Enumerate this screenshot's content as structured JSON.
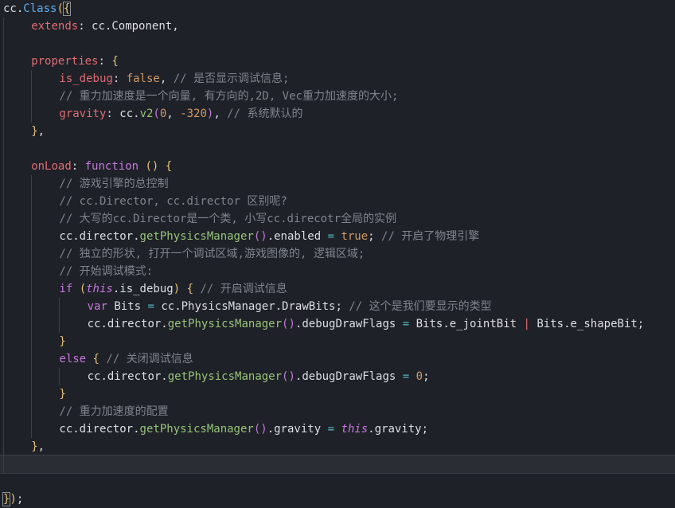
{
  "editor": {
    "lines": [
      {
        "indent": 0,
        "tokens": [
          [
            "cc.",
            ""
          ],
          [
            "Class",
            "fn"
          ],
          [
            "(",
            "br"
          ],
          [
            "{",
            "hl"
          ]
        ]
      },
      {
        "indent": 1,
        "tokens": [
          [
            "extends",
            "prop"
          ],
          [
            ": cc.Component,",
            ""
          ]
        ]
      },
      {
        "indent": 1,
        "tokens": []
      },
      {
        "indent": 1,
        "tokens": [
          [
            "properties",
            "prop"
          ],
          [
            ": ",
            ""
          ],
          [
            "{",
            "br"
          ]
        ]
      },
      {
        "indent": 2,
        "tokens": [
          [
            "is_debug",
            "prop"
          ],
          [
            ": ",
            ""
          ],
          [
            "false",
            "num"
          ],
          [
            ", ",
            ""
          ],
          [
            "// 是否显示调试信息;",
            "cm"
          ]
        ]
      },
      {
        "indent": 2,
        "tokens": [
          [
            "// 重力加速度是一个向量, 有方向的,2D, Vec重力加速度的大小;",
            "cm"
          ]
        ]
      },
      {
        "indent": 2,
        "tokens": [
          [
            "gravity",
            "prop"
          ],
          [
            ": cc.",
            ""
          ],
          [
            "v2",
            "fn-g"
          ],
          [
            "(",
            "pb"
          ],
          [
            "0",
            "num"
          ],
          [
            ", ",
            ""
          ],
          [
            "-320",
            "num"
          ],
          [
            ")",
            "pb"
          ],
          [
            ", ",
            ""
          ],
          [
            "// 系统默认的",
            "cm"
          ]
        ]
      },
      {
        "indent": 1,
        "tokens": [
          [
            "}",
            "br"
          ],
          [
            ",",
            ""
          ]
        ]
      },
      {
        "indent": 1,
        "tokens": []
      },
      {
        "indent": 1,
        "tokens": [
          [
            "onLoad",
            "prop"
          ],
          [
            ": ",
            ""
          ],
          [
            "function",
            "kw"
          ],
          [
            " ",
            ""
          ],
          [
            "()",
            "br"
          ],
          [
            " ",
            ""
          ],
          [
            "{",
            "br"
          ]
        ]
      },
      {
        "indent": 2,
        "tokens": [
          [
            "// 游戏引擎的总控制",
            "cm"
          ]
        ]
      },
      {
        "indent": 2,
        "tokens": [
          [
            "// cc.Director, cc.director 区别呢?",
            "cm"
          ]
        ]
      },
      {
        "indent": 2,
        "tokens": [
          [
            "// 大写的cc.Director是一个类, 小写cc.direcotr全局的实例",
            "cm"
          ]
        ]
      },
      {
        "indent": 2,
        "tokens": [
          [
            "cc.director.",
            ""
          ],
          [
            "getPhysicsManager",
            "fn-g"
          ],
          [
            "()",
            "pb"
          ],
          [
            ".enabled ",
            ""
          ],
          [
            "=",
            "op"
          ],
          [
            " ",
            ""
          ],
          [
            "true",
            "num"
          ],
          [
            "; ",
            ""
          ],
          [
            "// 开启了物理引擎",
            "cm"
          ]
        ]
      },
      {
        "indent": 2,
        "tokens": [
          [
            "// 独立的形状, 打开一个调试区域,游戏图像的, 逻辑区域;",
            "cm"
          ]
        ]
      },
      {
        "indent": 2,
        "tokens": [
          [
            "// 开始调试模式:",
            "cm"
          ]
        ]
      },
      {
        "indent": 2,
        "tokens": [
          [
            "if",
            "kw"
          ],
          [
            " ",
            ""
          ],
          [
            "(",
            "br"
          ],
          [
            "this",
            "kwi"
          ],
          [
            ".is_debug",
            ""
          ],
          [
            ")",
            "br"
          ],
          [
            " ",
            ""
          ],
          [
            "{",
            "br"
          ],
          [
            " ",
            ""
          ],
          [
            "// 开启调试信息",
            "cm"
          ]
        ]
      },
      {
        "indent": 3,
        "tokens": [
          [
            "var",
            "kw"
          ],
          [
            " Bits ",
            ""
          ],
          [
            "=",
            "op"
          ],
          [
            " cc.PhysicsManager.DrawBits; ",
            ""
          ],
          [
            "// 这个是我们要显示的类型",
            "cm"
          ]
        ]
      },
      {
        "indent": 3,
        "tokens": [
          [
            "cc.director.",
            ""
          ],
          [
            "getPhysicsManager",
            "fn-g"
          ],
          [
            "()",
            "pb"
          ],
          [
            ".debugDrawFlags ",
            ""
          ],
          [
            "=",
            "op"
          ],
          [
            " Bits.e_jointBit ",
            ""
          ],
          [
            "|",
            "prop"
          ],
          [
            " Bits.e_shapeBit;",
            ""
          ]
        ]
      },
      {
        "indent": 2,
        "tokens": [
          [
            "}",
            "br"
          ]
        ]
      },
      {
        "indent": 2,
        "tokens": [
          [
            "else",
            "kw"
          ],
          [
            " ",
            ""
          ],
          [
            "{",
            "br"
          ],
          [
            " ",
            ""
          ],
          [
            "// 关闭调试信息",
            "cm"
          ]
        ]
      },
      {
        "indent": 3,
        "tokens": [
          [
            "cc.director.",
            ""
          ],
          [
            "getPhysicsManager",
            "fn-g"
          ],
          [
            "()",
            "pb"
          ],
          [
            ".debugDrawFlags ",
            ""
          ],
          [
            "=",
            "op"
          ],
          [
            " ",
            ""
          ],
          [
            "0",
            "num"
          ],
          [
            ";",
            ""
          ]
        ]
      },
      {
        "indent": 2,
        "tokens": [
          [
            "}",
            "br"
          ]
        ]
      },
      {
        "indent": 2,
        "tokens": [
          [
            "// 重力加速度的配置",
            "cm"
          ]
        ]
      },
      {
        "indent": 2,
        "tokens": [
          [
            "cc.director.",
            ""
          ],
          [
            "getPhysicsManager",
            "fn-g"
          ],
          [
            "()",
            "pb"
          ],
          [
            ".gravity ",
            ""
          ],
          [
            "=",
            "op"
          ],
          [
            " ",
            ""
          ],
          [
            "this",
            "kwi"
          ],
          [
            ".gravity;",
            ""
          ]
        ]
      },
      {
        "indent": 1,
        "tokens": [
          [
            "}",
            "br"
          ],
          [
            ",",
            ""
          ]
        ]
      },
      {
        "indent": 1,
        "tokens": [],
        "current": true
      },
      {
        "indent": 0,
        "tokens": []
      },
      {
        "indent": 0,
        "tokens": [
          [
            "}",
            "hl"
          ],
          [
            ")",
            "br"
          ],
          [
            ";",
            ""
          ]
        ]
      }
    ]
  }
}
